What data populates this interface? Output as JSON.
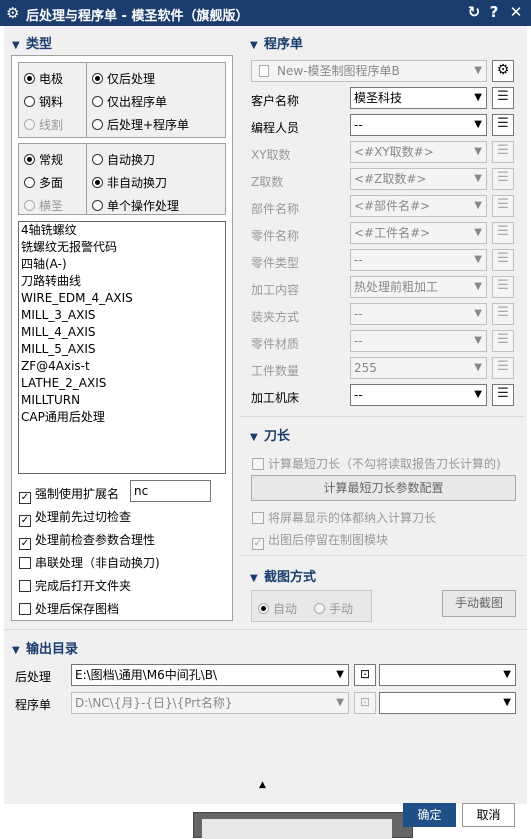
{
  "window": {
    "title": "后处理与程序单 - 模圣软件（旗舰版）",
    "reset_icon": "reset-icon",
    "help_icon": "help-icon",
    "close_icon": "close-icon"
  },
  "type_section": {
    "title": "类型",
    "material": [
      {
        "label": "电极",
        "selected": true
      },
      {
        "label": "钢料",
        "selected": false
      },
      {
        "label": "线割",
        "selected": false,
        "disabled": true
      }
    ],
    "process": [
      {
        "label": "仅后处理",
        "selected": true
      },
      {
        "label": "仅出程序单",
        "selected": false
      },
      {
        "label": "后处理+程序单",
        "selected": false
      }
    ],
    "mode": [
      {
        "label": "常规",
        "selected": true
      },
      {
        "label": "多面",
        "selected": false
      },
      {
        "label": "横圣",
        "selected": false,
        "disabled": true
      }
    ],
    "toolchange": [
      {
        "label": "自动换刀",
        "selected": false
      },
      {
        "label": "非自动换刀",
        "selected": true
      },
      {
        "label": "单个操作处理",
        "selected": false
      }
    ],
    "postprocessors": [
      "4轴铣螺纹",
      "铣螺纹无报警代码",
      "四轴(A-)",
      "刀路转曲线",
      "WIRE_EDM_4_AXIS",
      "MILL_3_AXIS",
      "MILL_4_AXIS",
      "MILL_5_AXIS",
      "ZF@4Axis-t",
      "LATHE_2_AXIS",
      "MILLTURN",
      "CAP通用后处理"
    ],
    "options": [
      {
        "label": "强制使用扩展名",
        "checked": true
      },
      {
        "label": "处理前先过切检查",
        "checked": true
      },
      {
        "label": "处理前检查参数合理性",
        "checked": true
      },
      {
        "label": "串联处理（非自动换刀)",
        "checked": false
      },
      {
        "label": "完成后打开文件夹",
        "checked": false
      },
      {
        "label": "处理后保存图档",
        "checked": false
      }
    ],
    "extension_value": "nc"
  },
  "program_sheet": {
    "title": "程序单",
    "template": "New-模圣制图程序单B",
    "fields": [
      {
        "label": "客户名称",
        "value": "模圣科技",
        "enabled": true
      },
      {
        "label": "编程人员",
        "value": "--",
        "enabled": true
      },
      {
        "label": "XY取数",
        "value": "<#XY取数#>",
        "enabled": false
      },
      {
        "label": "Z取数",
        "value": "<#Z取数#>",
        "enabled": false
      },
      {
        "label": "部件名称",
        "value": "<#部件名#>",
        "enabled": false
      },
      {
        "label": "零件名称",
        "value": "<#工件名#>",
        "enabled": false
      },
      {
        "label": "零件类型",
        "value": "--",
        "enabled": false
      },
      {
        "label": "加工内容",
        "value": "热处理前粗加工",
        "enabled": false
      },
      {
        "label": "装夹方式",
        "value": "--",
        "enabled": false
      },
      {
        "label": "零件材质",
        "value": "--",
        "enabled": false
      },
      {
        "label": "工件数量",
        "value": "255",
        "enabled": false
      },
      {
        "label": "加工机床",
        "value": "--",
        "enabled": true
      }
    ]
  },
  "tool_section": {
    "title": "刀长",
    "calc_shortest": "计算最短刀长（不勾将读取报告刀长计算的)",
    "config_button": "计算最短刀长参数配置",
    "include_screen": "将屏幕显示的体都纳入计算刀长",
    "stay_in_drawing": "出图后停留在制图模块",
    "stay_checked": true
  },
  "capture_section": {
    "title": "截图方式",
    "auto": "自动",
    "manual": "手动",
    "manual_button": "手动截图"
  },
  "output_section": {
    "title": "输出目录",
    "post_label": "后处理",
    "post_path": "E:\\图档\\通用\\M6中间孔\\B\\",
    "sheet_label": "程序单",
    "sheet_path": "D:\\NC\\{月}-{日}\\{Prt名称}"
  },
  "footer": {
    "ok": "确定",
    "cancel": "取消"
  },
  "colors": {
    "title_bg": "#1b3d6e",
    "accent": "#1b3d6e",
    "ok_bg": "#1f4f86"
  }
}
